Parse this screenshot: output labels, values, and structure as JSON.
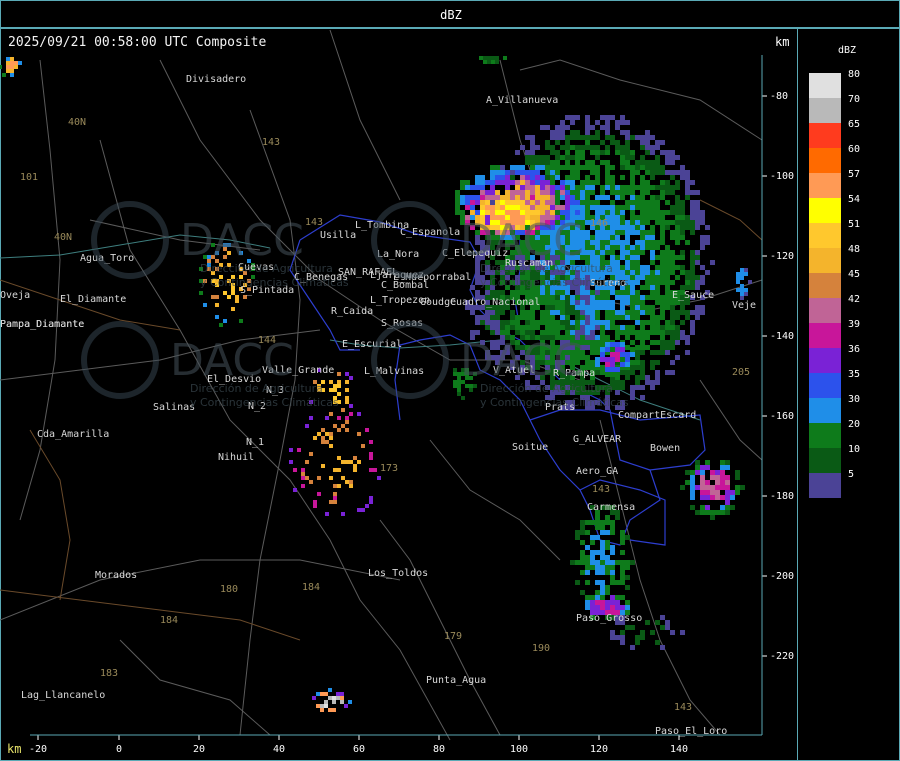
{
  "header": {
    "title": "dBZ"
  },
  "map": {
    "timestamp": "2025/09/21 00:58:00 UTC Composite",
    "km_label_top": "km",
    "km_label_bottom": "km",
    "watermark_text": [
      "DACC",
      "Dirección de Agricultura",
      "y Contingencias Climáticas"
    ],
    "x_ticks": [
      "-20",
      "0",
      "20",
      "40",
      "60",
      "80",
      "100",
      "120",
      "140"
    ],
    "y_ticks": [
      "-80",
      "-100",
      "-120",
      "-140",
      "-160",
      "-180",
      "-200",
      "-220"
    ],
    "places": [
      "Divisadero",
      "A_Villanueva",
      "L_Tombina",
      "Usilla",
      "C_Espanola",
      "La_Nora",
      "C_Elepequiz",
      "Ruscaman",
      "Agua_Toro",
      "El_Diamante",
      "Pampa_Diamante",
      "Goudge",
      "C_Benegas",
      "SAN_RAFAEL",
      "L_Hueporrabal",
      "C_Bombal",
      "Ljaraguez",
      "L_Tropezon",
      "Cuadro_Nacional",
      "R_Caida",
      "S_Rosas",
      "Sureno",
      "E_Escurial",
      "Valle_Grande",
      "L_Malvinas",
      "El_Desvio",
      "Salinas",
      "Cda_Amarilla",
      "Nihuil",
      "V_Atuel",
      "R_Pampa",
      "Prats",
      "CompartEscard",
      "G_ALVEAR",
      "Bowen",
      "Soitue",
      "Aero_GA",
      "Carmensa",
      "Los_Toldos",
      "Morados",
      "Punta_Agua",
      "Lag_Llancanelo",
      "Paso_Grosso",
      "Paso_El_Loro",
      "Pampa_Diamante",
      "N_2",
      "N_1",
      "N_3",
      "S_Pintada",
      "Cuevas",
      "Veje",
      "E_Sauce",
      "Oveja"
    ],
    "route_labels": [
      "143",
      "143",
      "40N",
      "101",
      "40N",
      "144",
      "173",
      "180",
      "184",
      "184",
      "183",
      "179",
      "190",
      "205",
      "143",
      "143",
      "146"
    ]
  },
  "legend": {
    "title": "dBZ",
    "entries": [
      {
        "value": "80",
        "color": "#e0e0e0"
      },
      {
        "value": "70",
        "color": "#b9b9b9"
      },
      {
        "value": "65",
        "color": "#ff3b1e"
      },
      {
        "value": "60",
        "color": "#ff6a00"
      },
      {
        "value": "57",
        "color": "#ff9a55"
      },
      {
        "value": "54",
        "color": "#ffff00"
      },
      {
        "value": "51",
        "color": "#ffc82d"
      },
      {
        "value": "48",
        "color": "#f4b42c"
      },
      {
        "value": "45",
        "color": "#d5823c"
      },
      {
        "value": "42",
        "color": "#c06496"
      },
      {
        "value": "39",
        "color": "#c8169a"
      },
      {
        "value": "36",
        "color": "#7a22d6"
      },
      {
        "value": "35",
        "color": "#2c52ec"
      },
      {
        "value": "30",
        "color": "#1f8ee8"
      },
      {
        "value": "20",
        "color": "#0e7b1b"
      },
      {
        "value": "10",
        "color": "#0a5a15"
      },
      {
        "value": "5",
        "color": "#4b4396"
      }
    ]
  }
}
